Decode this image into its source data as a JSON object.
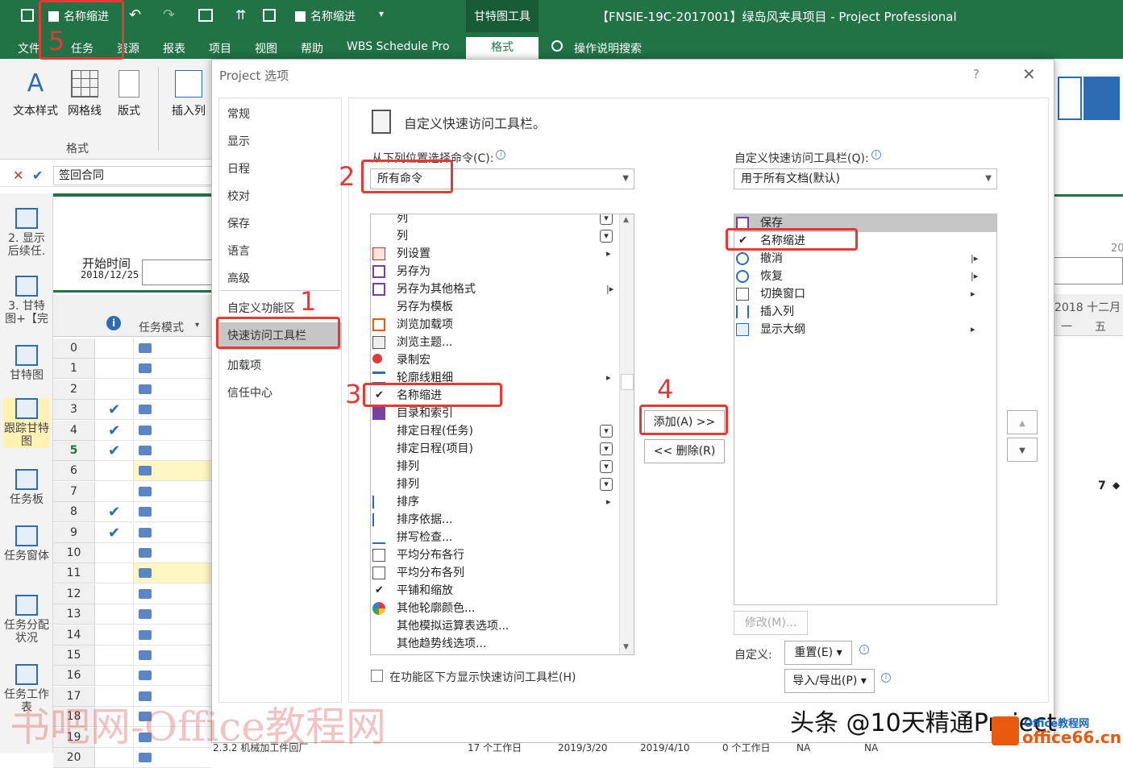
{
  "title_bar": {
    "qat_checkbox_1": "名称缩进",
    "qat_checkbox_2": "名称缩进",
    "tool_group": "甘特图工具",
    "window_title": "【FNSIE-19C-2017001】绿岛风夹具项目 - Project Professional"
  },
  "ribbon_tabs": [
    "文件",
    "任务",
    "资源",
    "报表",
    "项目",
    "视图",
    "帮助",
    "WBS Schedule Pro"
  ],
  "format_tab": "格式",
  "tell_me": "操作说明搜索",
  "ribbon": {
    "buttons": [
      "文本样式",
      "网格线",
      "版式",
      "插入列"
    ],
    "group_label": "格式"
  },
  "formula_bar": {
    "value": "签回合同"
  },
  "view_bar": [
    {
      "label": "2. 显示后续任."
    },
    {
      "label": "3. 甘特图+【完"
    },
    {
      "label": "甘特图"
    },
    {
      "label": "跟踪甘特图"
    },
    {
      "label": "任务板"
    },
    {
      "label": "任务窗体"
    },
    {
      "label": "任务分配状况"
    },
    {
      "label": "任务工作表"
    }
  ],
  "grid": {
    "start_label": "开始时间",
    "start_date": "2018/12/25",
    "col_mode": "任务模式",
    "rows": [
      {
        "id": "0",
        "check": ""
      },
      {
        "id": "1",
        "check": ""
      },
      {
        "id": "2",
        "check": ""
      },
      {
        "id": "3",
        "check": "✔"
      },
      {
        "id": "4",
        "check": "✔"
      },
      {
        "id": "5",
        "check": "✔"
      },
      {
        "id": "6",
        "check": ""
      },
      {
        "id": "7",
        "check": ""
      },
      {
        "id": "8",
        "check": "✔"
      },
      {
        "id": "9",
        "check": "✔"
      },
      {
        "id": "10",
        "check": ""
      },
      {
        "id": "11",
        "check": ""
      },
      {
        "id": "12",
        "check": ""
      },
      {
        "id": "13",
        "check": ""
      },
      {
        "id": "14",
        "check": ""
      },
      {
        "id": "15",
        "check": ""
      },
      {
        "id": "16",
        "check": ""
      },
      {
        "id": "17",
        "check": ""
      },
      {
        "id": "18",
        "check": ""
      },
      {
        "id": "19",
        "check": ""
      },
      {
        "id": "20",
        "check": ""
      }
    ],
    "bottom_row": [
      "2.3.2 机械加工件回厂",
      "17 个工作日",
      "2019/3/20",
      "2019/4/10",
      "0 个工作日",
      "NA",
      "NA"
    ]
  },
  "right_gantt": {
    "timescale": "2018 十二月",
    "day1": "一",
    "day2": "五",
    "tick": "20",
    "marker": "7"
  },
  "dialog": {
    "title": "Project 选项",
    "help": "?",
    "close": "✕",
    "nav": [
      "常规",
      "显示",
      "日程",
      "校对",
      "保存",
      "语言",
      "高级",
      "自定义功能区",
      "快速访问工具栏",
      "加载项",
      "信任中心"
    ],
    "heading": "自定义快速访问工具栏。",
    "choose_label": "从下列位置选择命令(C):",
    "choose_value": "所有命令",
    "customize_label": "自定义快速访问工具栏(Q):",
    "customize_value": "用于所有文档(默认)",
    "commands": [
      {
        "text": "列",
        "icon": "",
        "sub": "dropdown"
      },
      {
        "text": "列",
        "icon": "",
        "sub": "textbox"
      },
      {
        "text": "列设置",
        "icon": "columns",
        "sub": "arrow"
      },
      {
        "text": "另存为",
        "icon": "saveas",
        "sub": ""
      },
      {
        "text": "另存为其他格式",
        "icon": "saveas",
        "sub": "bararrow"
      },
      {
        "text": "另存为模板",
        "icon": "",
        "sub": ""
      },
      {
        "text": "浏览加载项",
        "icon": "addins",
        "sub": ""
      },
      {
        "text": "浏览主题...",
        "icon": "theme",
        "sub": ""
      },
      {
        "text": "录制宏",
        "icon": "macro",
        "sub": ""
      },
      {
        "text": "轮廓线粗细",
        "icon": "lines",
        "sub": "arrow"
      },
      {
        "text": "名称缩进",
        "icon": "check",
        "sub": ""
      },
      {
        "text": "目录和索引",
        "icon": "toc",
        "sub": ""
      },
      {
        "text": "排定日程(任务)",
        "icon": "",
        "sub": "dropdown"
      },
      {
        "text": "排定日程(项目)",
        "icon": "",
        "sub": "dropdown"
      },
      {
        "text": "排列",
        "icon": "",
        "sub": "dropdown"
      },
      {
        "text": "排列",
        "icon": "",
        "sub": "dropdown"
      },
      {
        "text": "排序",
        "icon": "sortaz",
        "sub": "arrow"
      },
      {
        "text": "排序依据...",
        "icon": "sortaz",
        "sub": ""
      },
      {
        "text": "拼写检查...",
        "icon": "spell",
        "sub": ""
      },
      {
        "text": "平均分布各行",
        "icon": "rows",
        "sub": ""
      },
      {
        "text": "平均分布各列",
        "icon": "cols",
        "sub": ""
      },
      {
        "text": "平铺和缩放",
        "icon": "check",
        "sub": ""
      },
      {
        "text": "其他轮廓颜色...",
        "icon": "color",
        "sub": ""
      },
      {
        "text": "其他模拟运算表选项...",
        "icon": "",
        "sub": ""
      },
      {
        "text": "其他趋势线选项...",
        "icon": "",
        "sub": ""
      }
    ],
    "toolbar_items": [
      {
        "text": "保存",
        "icon": "save",
        "sub": ""
      },
      {
        "text": "名称缩进",
        "icon": "check",
        "sub": ""
      },
      {
        "text": "撤消",
        "icon": "undo",
        "sub": "bararrow"
      },
      {
        "text": "恢复",
        "icon": "redo",
        "sub": "bararrow"
      },
      {
        "text": "切换窗口",
        "icon": "switch",
        "sub": "arrow"
      },
      {
        "text": "插入列",
        "icon": "insert",
        "sub": ""
      },
      {
        "text": "显示大纲",
        "icon": "outline",
        "sub": "arrow"
      }
    ],
    "add_button": "添加(A) >>",
    "remove_button": "<< 删除(R)",
    "modify_button": "修改(M)...",
    "customize_label2": "自定义:",
    "reset_button": "重置(E) ▾",
    "import_export_button": "导入/导出(P) ▾",
    "show_below_label": "在功能区下方显示快速访问工具栏(H)"
  },
  "annotations": {
    "n1": "1",
    "n2": "2",
    "n3": "3",
    "n4": "4",
    "n5": "5"
  },
  "watermarks": {
    "left": "书吧网-Office教程网",
    "right": "头条 @10天精通Project",
    "logo": "office66.cn",
    "logo_top": "Office教程网"
  }
}
